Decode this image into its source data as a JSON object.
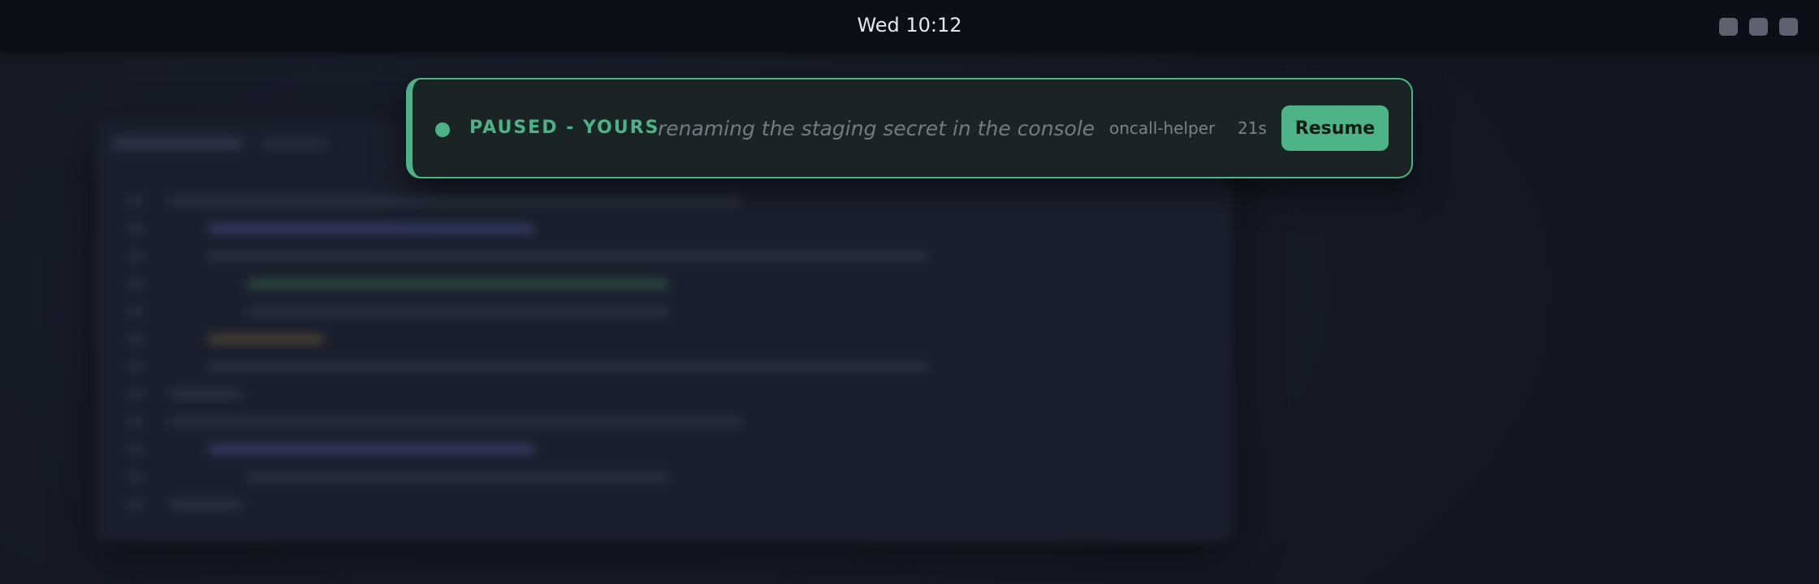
{
  "topbar": {
    "clock": "Wed 10:12",
    "tray_icons": [
      "tray-icon",
      "tray-icon",
      "tray-icon"
    ]
  },
  "notification": {
    "status": "PAUSED - YOURS",
    "message": "renaming the staging secret in the console",
    "source": "oncall-helper",
    "elapsed": "21s",
    "action_label": "Resume"
  },
  "colors": {
    "accent": "#4db386",
    "topbar_bg": "#0c0f17",
    "notification_bg": "#1b2424"
  }
}
